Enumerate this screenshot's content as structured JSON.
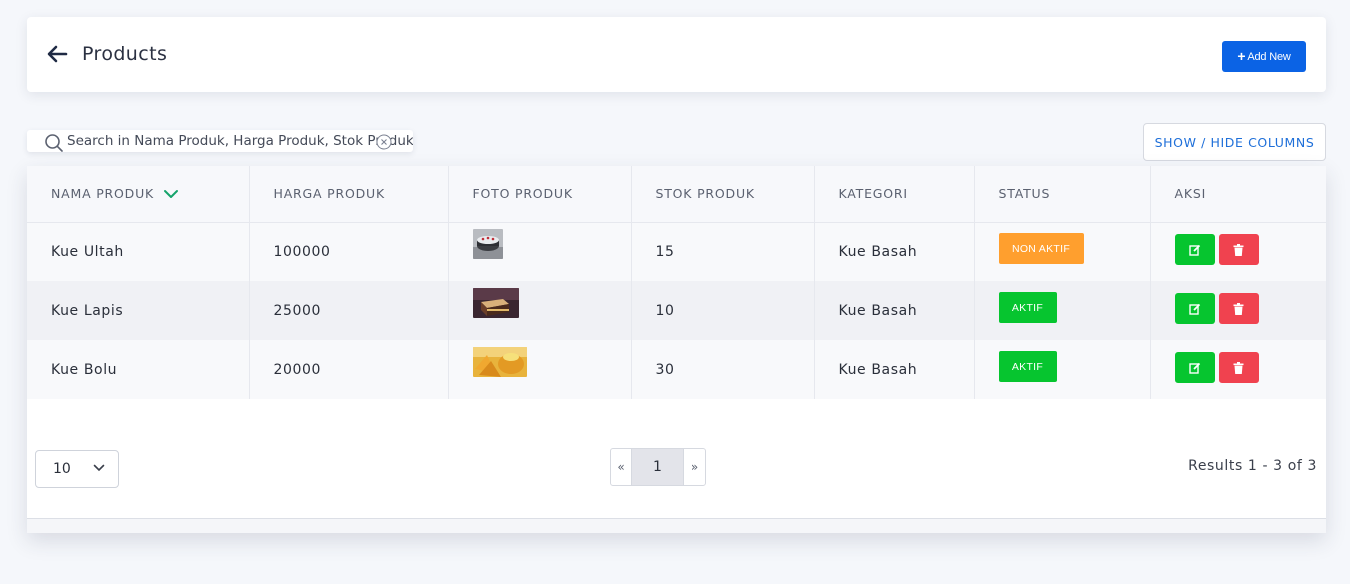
{
  "header": {
    "title": "Products",
    "add_label": "Add New"
  },
  "search": {
    "placeholder": "Search in Nama Produk, Harga Produk, Stok Produk, Ka"
  },
  "toolbar": {
    "showhide_label": "SHOW / HIDE COLUMNS"
  },
  "table": {
    "columns": [
      "NAMA PRODUK",
      "HARGA PRODUK",
      "FOTO PRODUK",
      "STOK PRODUK",
      "KATEGORI",
      "STATUS",
      "AKSI"
    ],
    "rows": [
      {
        "nama": "Kue Ultah",
        "harga": "100000",
        "stok": "15",
        "kategori": "Kue Basah",
        "status": "NON AKTIF"
      },
      {
        "nama": "Kue Lapis",
        "harga": "25000",
        "stok": "10",
        "kategori": "Kue Basah",
        "status": "AKTIF"
      },
      {
        "nama": "Kue Bolu",
        "harga": "20000",
        "stok": "30",
        "kategori": "Kue Basah",
        "status": "AKTIF"
      }
    ]
  },
  "pagination": {
    "per_page": "10",
    "prev": "«",
    "current": "1",
    "next": "»",
    "results": "Results 1 - 3 of 3"
  },
  "colors": {
    "primary": "#0b63e5",
    "success": "#06c52f",
    "warning": "#ff9f2e",
    "danger": "#f0424f",
    "sort_accent": "#15a36b"
  },
  "icons": {
    "back": "arrow-left-icon",
    "add": "plus-icon",
    "search": "search-icon",
    "clear": "clear-icon",
    "sort": "chevron-down-icon",
    "edit": "edit-icon",
    "delete": "trash-icon"
  }
}
